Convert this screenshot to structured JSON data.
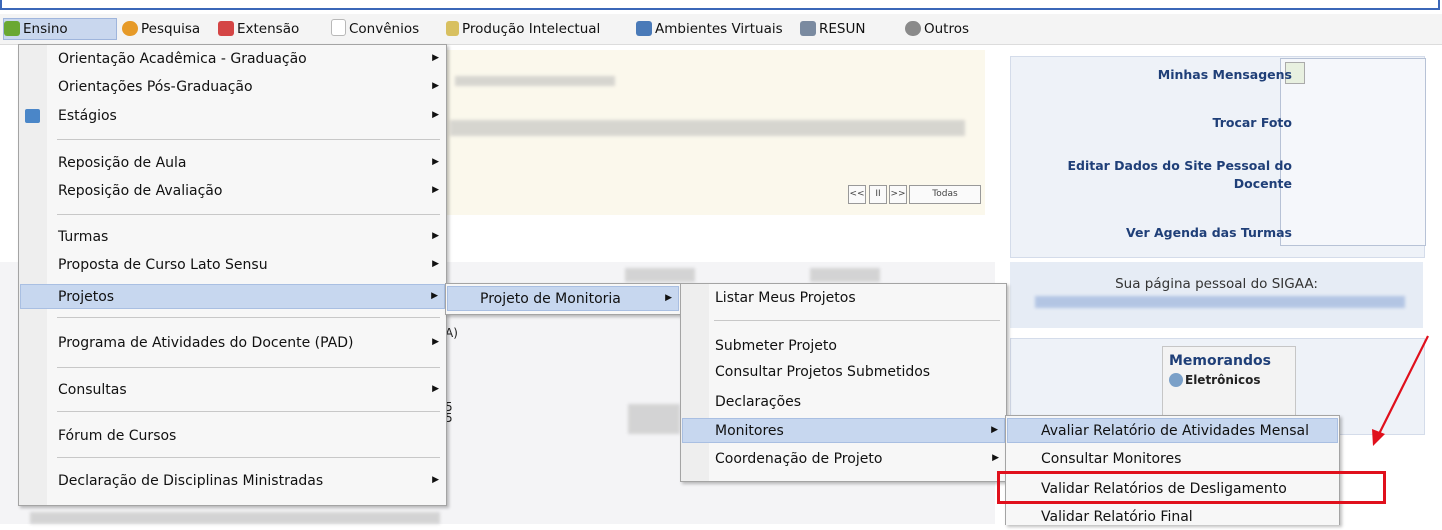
{
  "menubar": {
    "items": [
      {
        "label": "Ensino",
        "icon": "book-stack-icon",
        "color": "#6aa832"
      },
      {
        "label": "Pesquisa",
        "icon": "flask-icon",
        "color": "#e69a28"
      },
      {
        "label": "Extensão",
        "icon": "heart-hands-icon",
        "color": "#d44545"
      },
      {
        "label": "Convênios",
        "icon": "document-icon",
        "color": "#b8b8b8"
      },
      {
        "label": "Produção Intelectual",
        "icon": "notebook-icon",
        "color": "#d8c060"
      },
      {
        "label": "Ambientes Virtuais",
        "icon": "network-icon",
        "color": "#4a7ab8"
      },
      {
        "label": "RESUN",
        "icon": "folder-icon",
        "color": "#7a8aa0"
      },
      {
        "label": "Outros",
        "icon": "people-icon",
        "color": "#8a8a8a"
      }
    ]
  },
  "menu1": {
    "items": [
      "Orientação Acadêmica - Graduação",
      "Orientações Pós-Graduação",
      "Estágios",
      "Reposição de Aula",
      "Reposição de Avaliação",
      "Turmas",
      "Proposta de Curso Lato Sensu",
      "Projetos",
      "Programa de Atividades do Docente (PAD)",
      "Consultas",
      "Fórum de Cursos",
      "Declaração de Disciplinas Ministradas"
    ]
  },
  "menu2": {
    "items": [
      "Projeto de Monitoria"
    ]
  },
  "menu3": {
    "items": [
      "Listar Meus Projetos",
      "Submeter Projeto",
      "Consultar Projetos Submetidos",
      "Declarações",
      "Monitores",
      "Coordenação de Projeto"
    ]
  },
  "menu4": {
    "items": [
      "Avaliar Relatório de Atividades Mensal",
      "Consultar Monitores",
      "Validar Relatórios de Desligamento",
      "Validar Relatório Final"
    ]
  },
  "sidebar": {
    "links": [
      "Minhas Mensagens",
      "Trocar Foto",
      "Editar Dados do Site Pessoal do",
      "Docente",
      "Ver Agenda das Turmas"
    ],
    "personal_page": "Sua página pessoal do SIGAA:",
    "memo_title": "Memorandos",
    "memo_sub": "Eletrônicos"
  },
  "pager": {
    "prev": "<<",
    "pause": "II",
    "next": ">>",
    "all": "Todas"
  },
  "fragments": {
    "a": "A)",
    "five1": "5",
    "five2": "5"
  },
  "colors": {
    "highlight": "#c7d7ef",
    "link": "#1f3f78",
    "annotation": "#e0101c"
  }
}
